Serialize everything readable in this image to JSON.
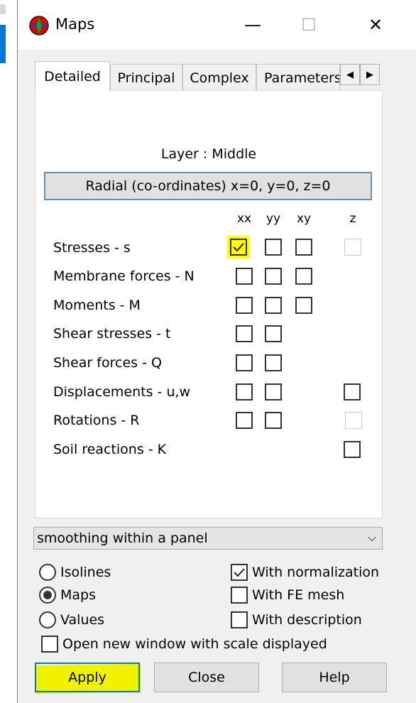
{
  "window": {
    "title": "Maps",
    "minimize_glyph": "—",
    "maximize_glyph": "☐",
    "close_glyph": "✕"
  },
  "tabs": [
    {
      "label": "Detailed",
      "active": true
    },
    {
      "label": "Principal",
      "active": false
    },
    {
      "label": "Complex",
      "active": false
    },
    {
      "label": "Parameters",
      "active": false
    }
  ],
  "tab_scroll": {
    "left": "◀",
    "right": "▶"
  },
  "panel": {
    "layer_label": "Layer : Middle",
    "radial_button": "Radial (co-ordinates) x=0, y=0, z=0",
    "columns": [
      "xx",
      "yy",
      "xy",
      "z"
    ],
    "rows": [
      {
        "label": "Stresses - s"
      },
      {
        "label": "Membrane forces - N"
      },
      {
        "label": "Moments - M"
      },
      {
        "label": "Shear stresses - t"
      },
      {
        "label": "Shear forces - Q"
      },
      {
        "label": "Displacements - u,w"
      },
      {
        "label": "Rotations - R"
      },
      {
        "label": "Soil reactions - K"
      }
    ],
    "checked": "Stresses - s / xx"
  },
  "dropdown": {
    "value": "smoothing within a panel",
    "chevron": "⌵"
  },
  "display_options": {
    "isolines": "Isolines",
    "maps": "Maps",
    "values": "Values",
    "selected": "Maps"
  },
  "flags": {
    "with_normalization": "With normalization",
    "with_fe_mesh": "With FE mesh",
    "with_description": "With description",
    "open_new_window": "Open new window with scale displayed"
  },
  "buttons": {
    "apply": "Apply",
    "close": "Close",
    "help": "Help"
  },
  "colors": {
    "highlight": "#ffff00",
    "accent": "#0078d7"
  }
}
